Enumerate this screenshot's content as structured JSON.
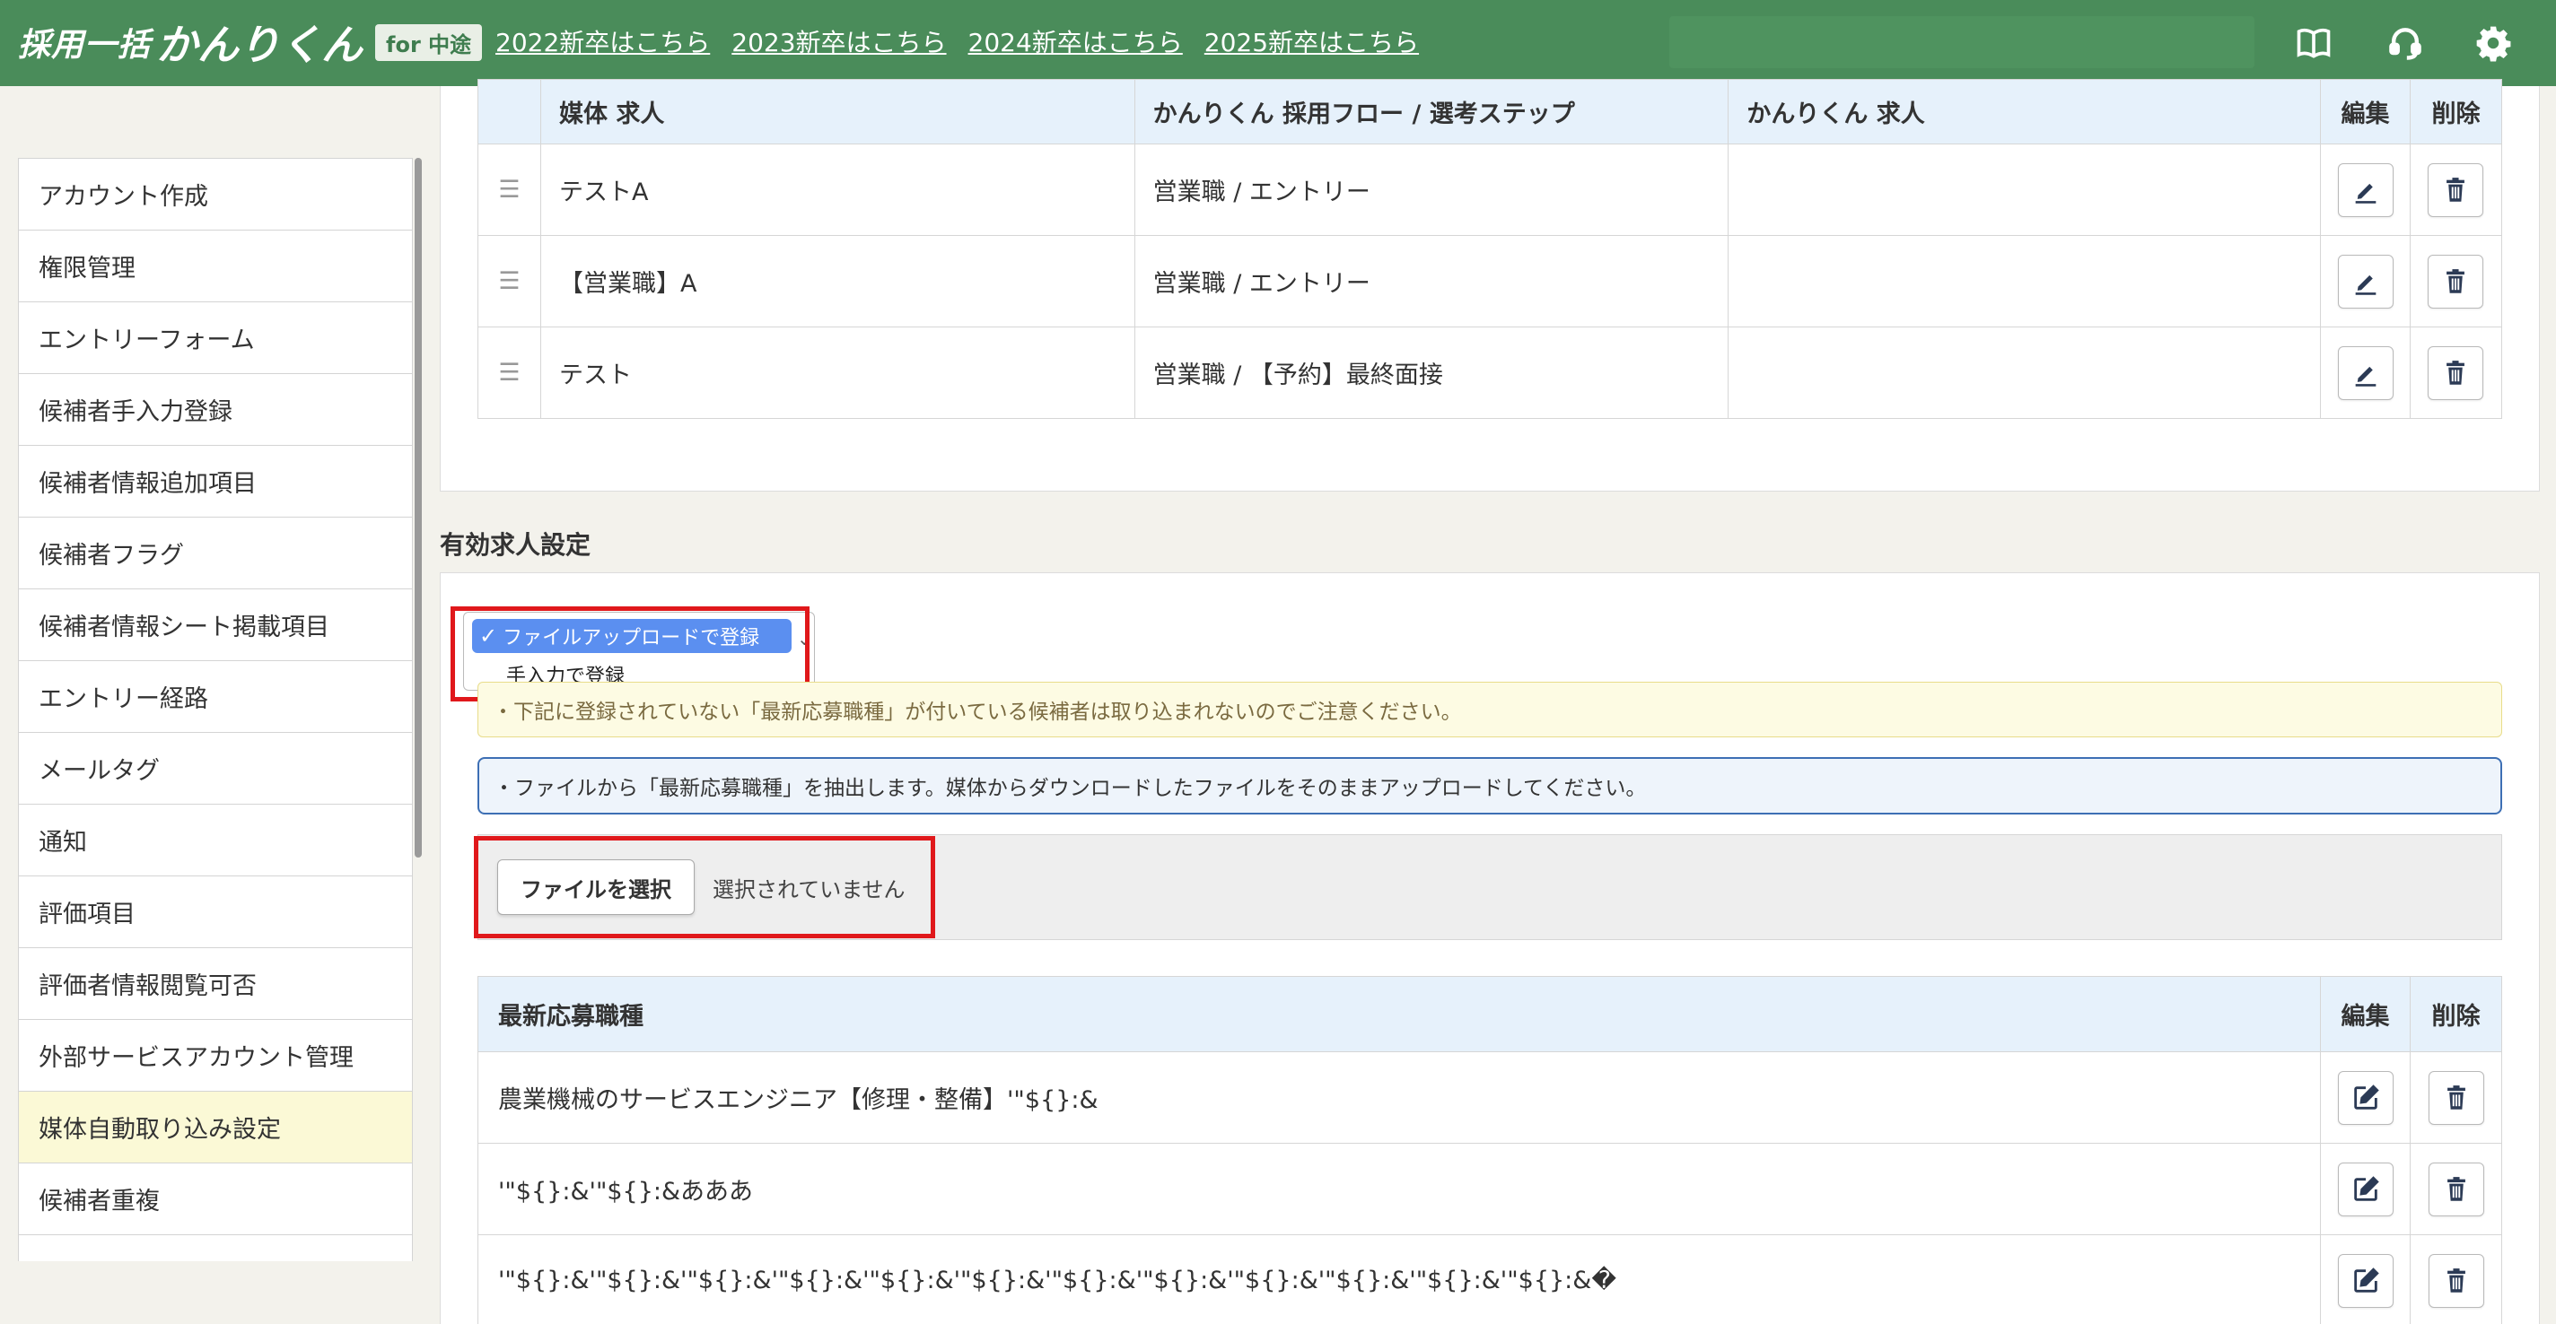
{
  "header": {
    "logo_text": "採用一括",
    "logo_big": "かんりくん",
    "logo_tag": "for 中途",
    "year_links": [
      "2022新卒はこちら",
      "2023新卒はこちら",
      "2024新卒はこちら",
      "2025新卒はこちら"
    ],
    "icons": [
      "book-icon",
      "headset-icon",
      "gear-icon"
    ],
    "bg_color": "#4a8c5a"
  },
  "sidebar": {
    "items": [
      "アカウント作成",
      "権限管理",
      "エントリーフォーム",
      "候補者手入力登録",
      "候補者情報追加項目",
      "候補者フラグ",
      "候補者情報シート掲載項目",
      "エントリー経路",
      "メールタグ",
      "通知",
      "評価項目",
      "評価者情報閲覧可否",
      "外部サービスアカウント管理",
      "媒体自動取り込み設定",
      "候補者重複"
    ],
    "active_index": 13
  },
  "top_table": {
    "headers": [
      "媒体 求人",
      "かんりくん 採用フロー / 選考ステップ",
      "かんりくん 求人",
      "編集",
      "削除"
    ],
    "rows": [
      {
        "media_job": "テストA",
        "flow_step": "営業職 / エントリー",
        "kanri_job": ""
      },
      {
        "media_job": "【営業職】A",
        "flow_step": "営業職 / エントリー",
        "kanri_job": ""
      },
      {
        "media_job": "テスト",
        "flow_step": "営業職 / 【予約】最終面接",
        "kanri_job": ""
      }
    ]
  },
  "valid_jobs": {
    "section_title": "有効求人設定",
    "dropdown_options": [
      "ファイルアップロードで登録",
      "手入力で登録"
    ],
    "selected_option": "ファイルアップロードで登録",
    "notice_yellow": "・下記に登録されていない「最新応募職種」が付いている候補者は取り込まれないのでご注意ください。",
    "notice_blue": "・ファイルから「最新応募職種」を抽出します。媒体からダウンロードしたファイルをそのままアップロードしてください。",
    "file_button": "ファイルを選択",
    "file_status": "選択されていません"
  },
  "bottom_table": {
    "headers": [
      "最新応募職種",
      "編集",
      "削除"
    ],
    "rows": [
      "農業機械のサービスエンジニア【修理・整備】'\"${}:&",
      "'\"${}:&'\"${}:&あああ",
      "'\"${}:&'\"${}:&'\"${}:&'\"${}:&'\"${}:&'\"${}:&'\"${}:&'\"${}:&'\"${}:&'\"${}:&'\"${}:&'\"${}:&�"
    ]
  }
}
